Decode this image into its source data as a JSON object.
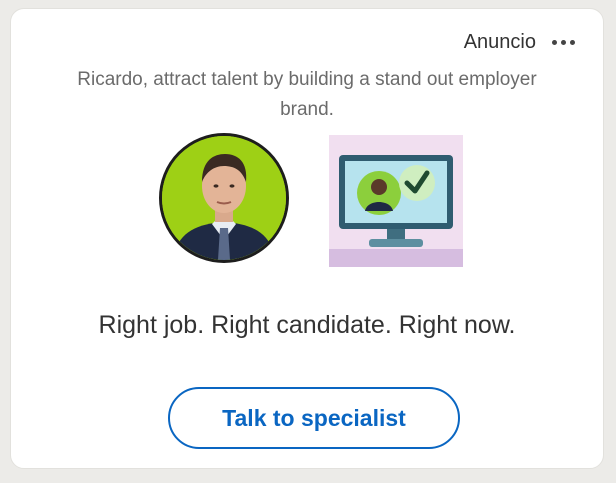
{
  "ad": {
    "label": "Anuncio",
    "more_icon": "more-horizontal-icon",
    "tagline": "Ricardo, attract talent by building a stand out employer brand.",
    "headline": "Right job. Right candidate. Right now.",
    "cta_label": "Talk to specialist"
  },
  "colors": {
    "accent": "#0a66c2",
    "avatar_ring": "#9ed015",
    "logo_background": "#f1dff0"
  }
}
